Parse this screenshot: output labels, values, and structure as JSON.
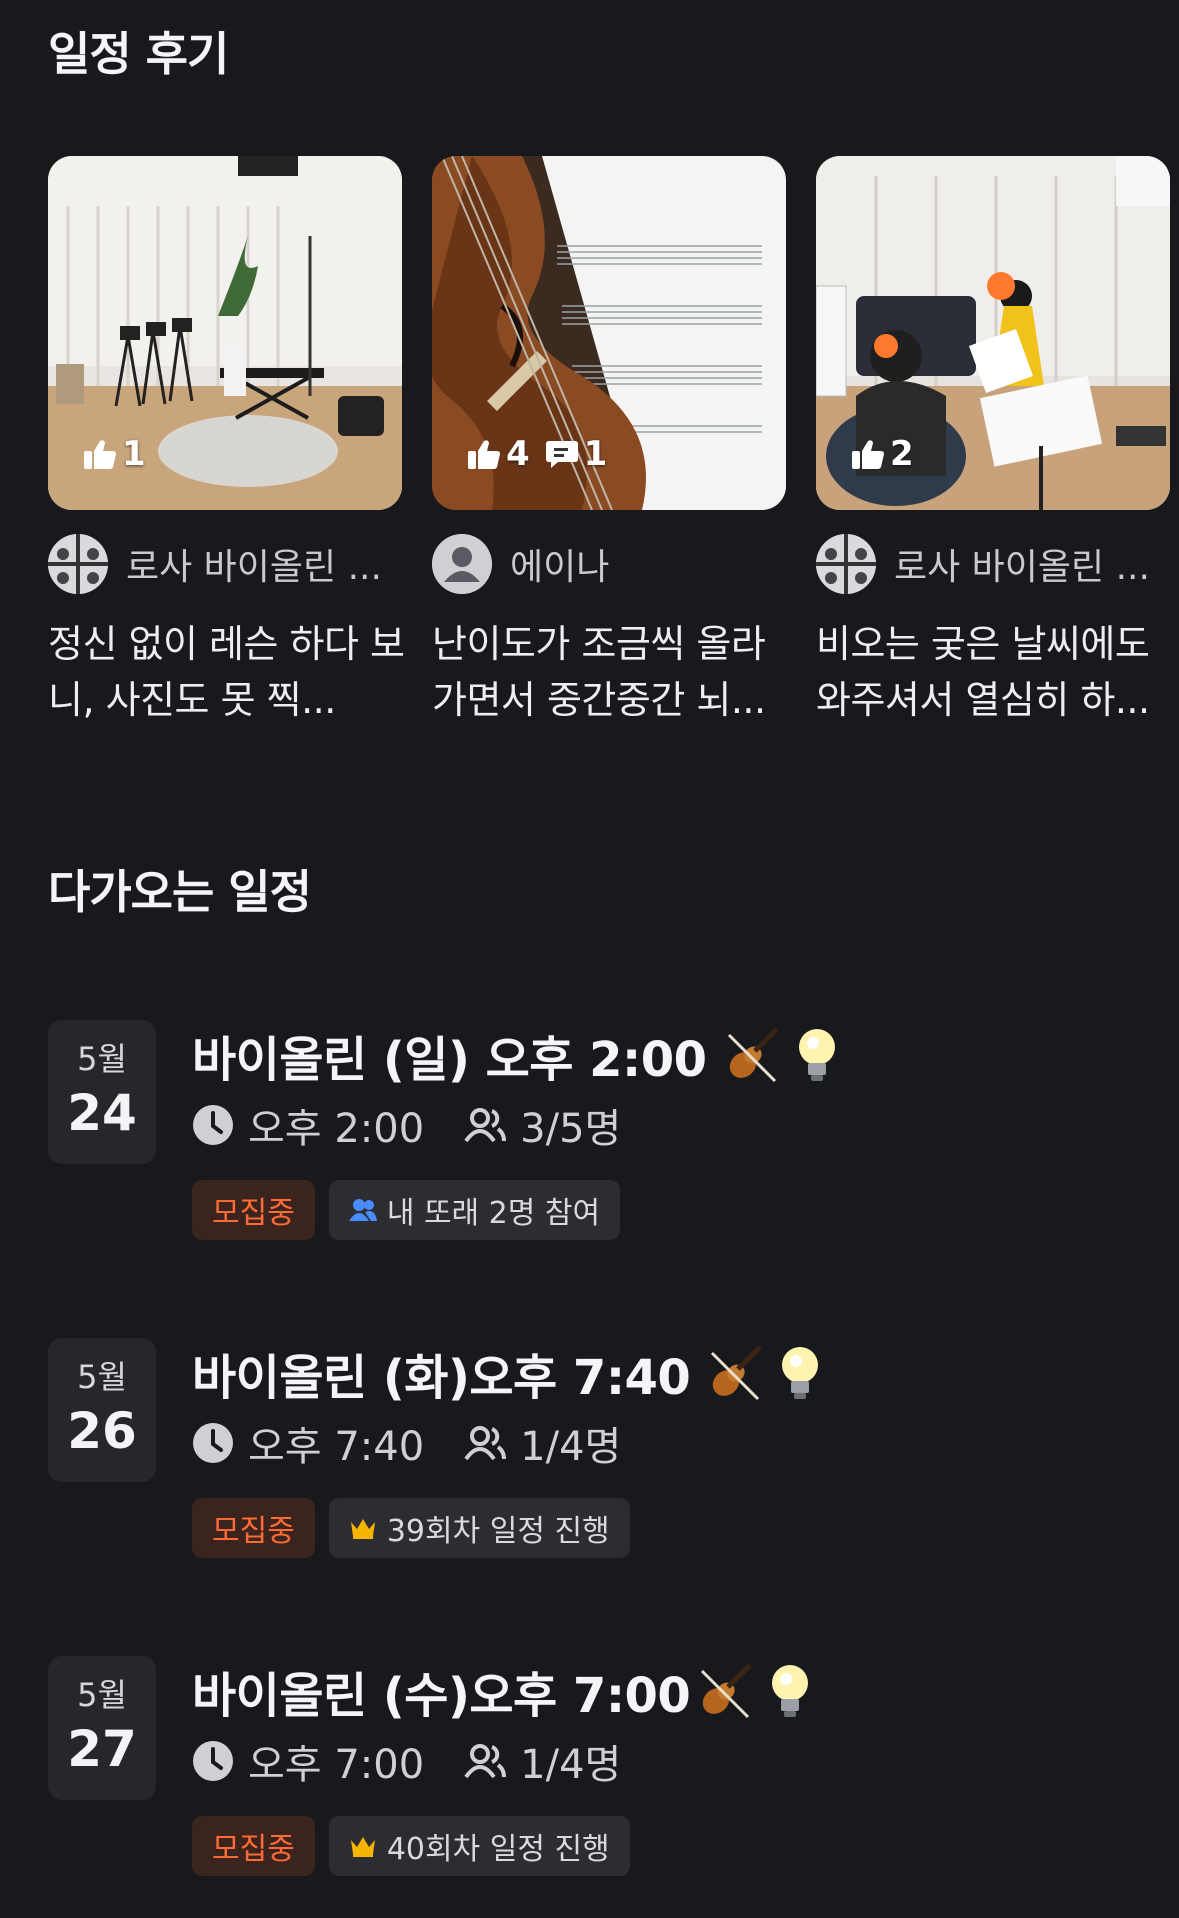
{
  "reviews_title": "일정 후기",
  "reviews": [
    {
      "author": "로사 바이올린 ...",
      "text": "정신 없이 레슨 하다 보니, 사진도 못 찍...",
      "likes": "1",
      "comments": ""
    },
    {
      "author": "에이나",
      "text": "난이도가 조금씩 올라 가면서 중간중간 뇌...",
      "likes": "4",
      "comments": "1"
    },
    {
      "author": "로사 바이올린 ...",
      "text": "비오는 궂은 날씨에도 와주셔서 열심히 하...",
      "likes": "2",
      "comments": ""
    }
  ],
  "upcoming_title": "다가오는 일정",
  "events": [
    {
      "month": "5월",
      "day": "24",
      "title": "바이올린 (일) 오후 2:00",
      "time": "오후 2:00",
      "members": "3/5명",
      "status": "모집중",
      "info_icon": "people-icon",
      "info": "내 또래 2명 참여"
    },
    {
      "month": "5월",
      "day": "26",
      "title": "바이올린 (화)오후 7:40",
      "time": "오후 7:40",
      "members": "1/4명",
      "status": "모집중",
      "info_icon": "crown-icon",
      "info": "39회차 일정 진행"
    },
    {
      "month": "5월",
      "day": "27",
      "title": "바이올린 (수)오후 7:00",
      "time": "오후 7:00",
      "members": "1/4명",
      "status": "모집중",
      "info_icon": "crown-icon",
      "info": "40회차 일정 진행"
    }
  ],
  "colors": {
    "background": "#18191d",
    "recruit": "#ff6a35",
    "crown": "#f5b400",
    "people": "#4a8cff"
  }
}
